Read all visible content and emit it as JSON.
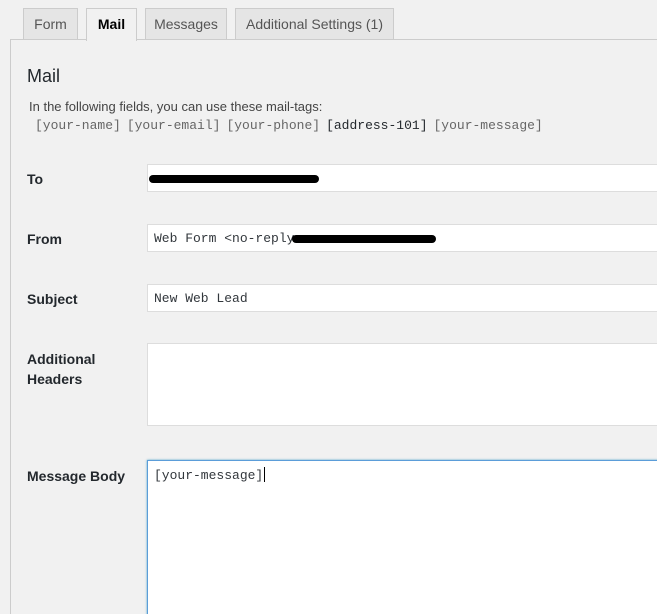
{
  "tabs": [
    {
      "label": "Form",
      "active": false
    },
    {
      "label": "Mail",
      "active": true
    },
    {
      "label": "Messages",
      "active": false
    },
    {
      "label": "Additional Settings (1)",
      "active": false
    }
  ],
  "mail": {
    "heading": "Mail",
    "hint": "In the following fields, you can use these mail-tags:",
    "tags": [
      {
        "text": "[your-name]",
        "used": false
      },
      {
        "text": "[your-email]",
        "used": false
      },
      {
        "text": "[your-phone]",
        "used": false
      },
      {
        "text": "[address-101]",
        "used": true
      },
      {
        "text": "[your-message]",
        "used": false
      }
    ],
    "fields": {
      "to": {
        "label": "To",
        "value": ""
      },
      "from": {
        "label": "From",
        "value": "Web Form <no-reply"
      },
      "subject": {
        "label": "Subject",
        "value": "New Web Lead"
      },
      "additional_headers": {
        "label": "Additional Headers",
        "value": ""
      },
      "message_body": {
        "label": "Message Body",
        "value": "[your-message]"
      }
    }
  },
  "colors": {
    "focus_border": "#5b9dd9",
    "panel_bg": "#f1f1f1",
    "tab_bg": "#e5e5e5"
  }
}
